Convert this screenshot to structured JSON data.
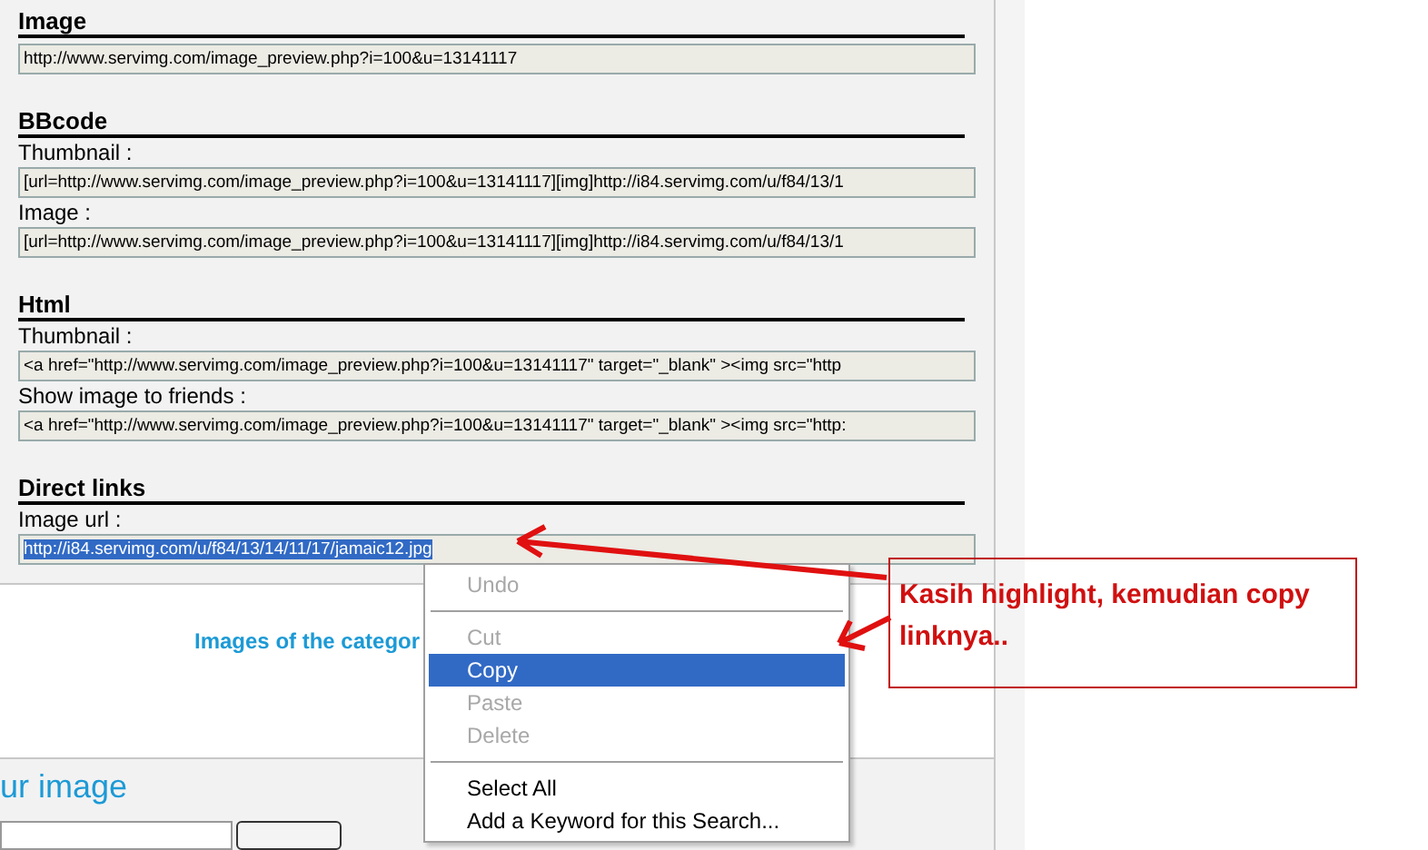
{
  "sections": [
    {
      "heading": "Image",
      "fields": [
        {
          "value": "http://www.servimg.com/image_preview.php?i=100&u=13141117",
          "selected": false
        }
      ]
    },
    {
      "heading": "BBcode",
      "fields": [
        {
          "label": "Thumbnail :",
          "value": "[url=http://www.servimg.com/image_preview.php?i=100&u=13141117][img]http://i84.servimg.com/u/f84/13/1",
          "selected": false
        },
        {
          "label": "Image :",
          "value": "[url=http://www.servimg.com/image_preview.php?i=100&u=13141117][img]http://i84.servimg.com/u/f84/13/1",
          "selected": false
        }
      ]
    },
    {
      "heading": "Html",
      "fields": [
        {
          "label": "Thumbnail :",
          "value": "<a href=\"http://www.servimg.com/image_preview.php?i=100&u=13141117\"  target=\"_blank\" ><img src=\"http",
          "selected": false
        },
        {
          "label": "Show image to friends :",
          "value": "<a href=\"http://www.servimg.com/image_preview.php?i=100&u=13141117\" target=\"_blank\" ><img src=\"http:",
          "selected": false
        }
      ]
    },
    {
      "heading": "Direct links",
      "fields": [
        {
          "label": "Image url :",
          "value": "http://i84.servimg.com/u/f84/13/14/11/17/jamaic12.jpg",
          "selected": true
        }
      ]
    }
  ],
  "category_link": "Images of the categor",
  "upload_heading": "ur image",
  "context_menu": [
    {
      "kind": "item",
      "label": "Undo",
      "disabled": true,
      "selected": false
    },
    {
      "kind": "separator"
    },
    {
      "kind": "item",
      "label": "Cut",
      "disabled": true,
      "selected": false
    },
    {
      "kind": "item",
      "label": "Copy",
      "disabled": false,
      "selected": true
    },
    {
      "kind": "item",
      "label": "Paste",
      "disabled": true,
      "selected": false
    },
    {
      "kind": "item",
      "label": "Delete",
      "disabled": true,
      "selected": false
    },
    {
      "kind": "separator"
    },
    {
      "kind": "item",
      "label": "Select All",
      "disabled": false,
      "selected": false
    },
    {
      "kind": "item",
      "label": "Add a Keyword for this Search...",
      "disabled": false,
      "selected": false
    }
  ],
  "annotation": "Kasih highlight, kemudian copy linknya.."
}
